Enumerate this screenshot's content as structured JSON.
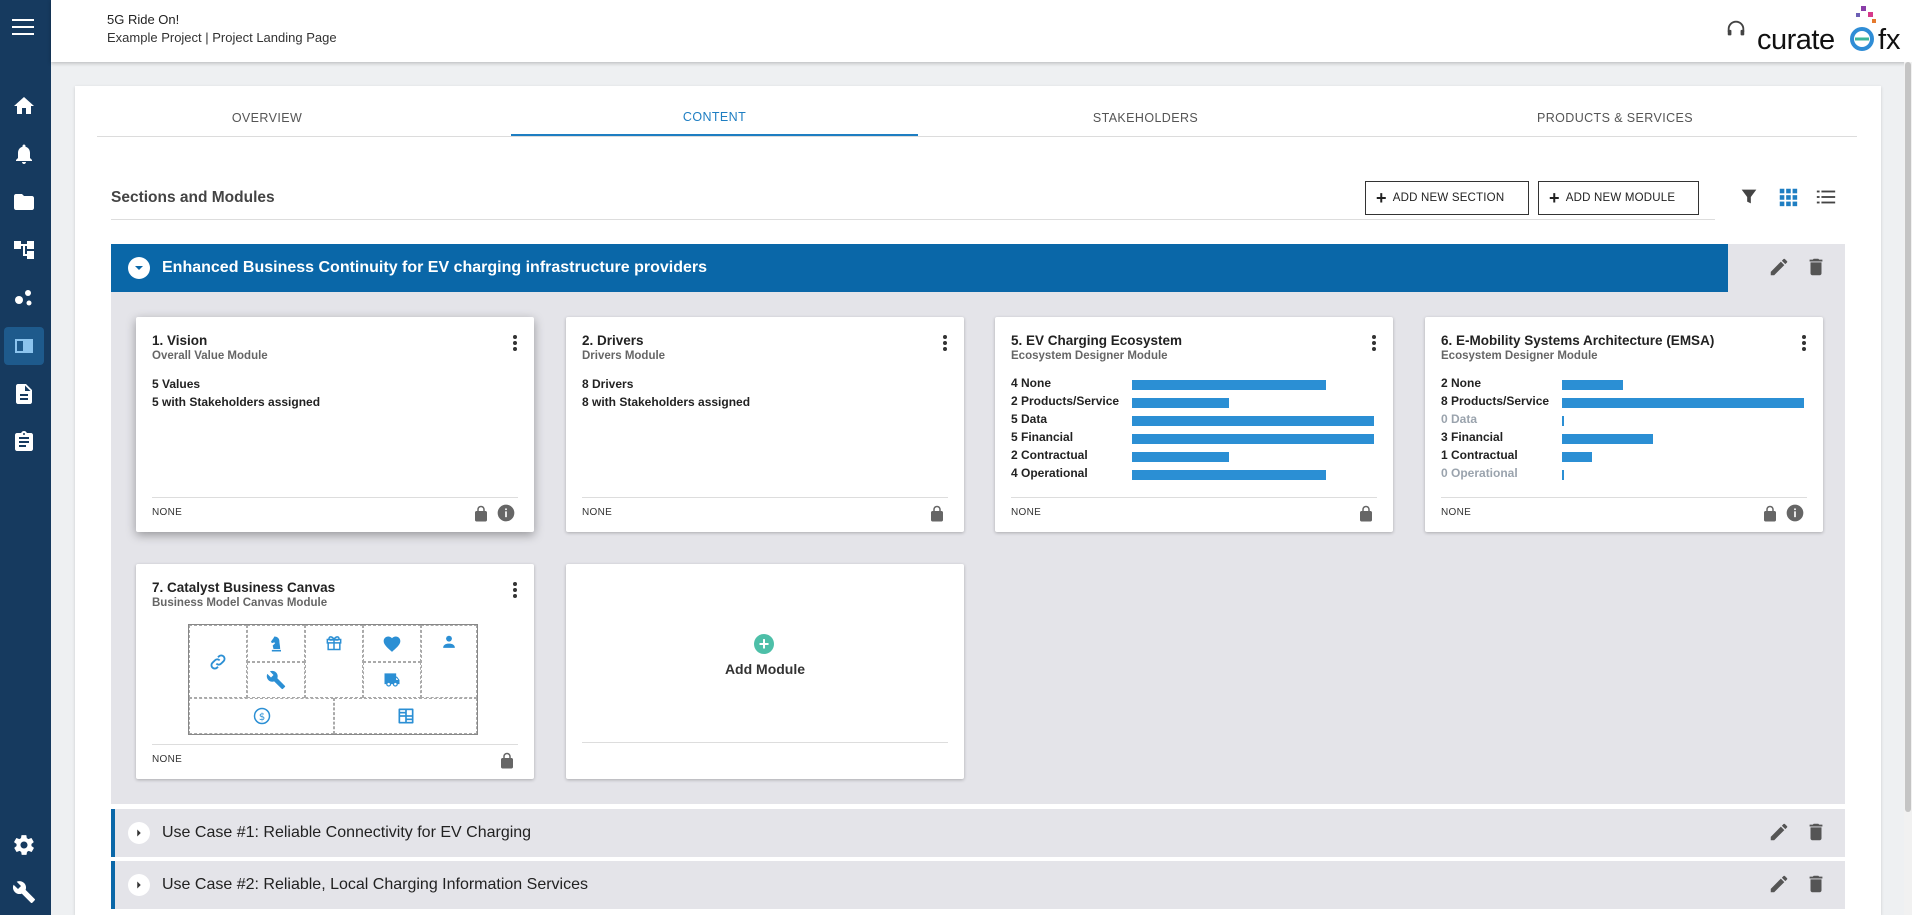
{
  "header": {
    "project_title": "5G Ride On!",
    "breadcrumb": "Example Project | Project Landing Page",
    "logo_word": "curate",
    "logo_suffix": "fx"
  },
  "nav": {
    "items": [
      "home-icon",
      "bell-icon",
      "folder-icon",
      "hierarchy-icon",
      "network-icon",
      "book-icon",
      "document-icon",
      "clipboard-icon"
    ],
    "bottom": [
      "gear-icon",
      "wrench-icon"
    ]
  },
  "tabs": [
    {
      "label": "OVERVIEW"
    },
    {
      "label": "CONTENT",
      "active": true
    },
    {
      "label": "STAKEHOLDERS"
    },
    {
      "label": "PRODUCTS & SERVICES"
    }
  ],
  "content": {
    "heading": "Sections and Modules",
    "add_section_label": "ADD NEW SECTION",
    "add_module_label": "ADD NEW MODULE"
  },
  "section": {
    "title": "Enhanced Business Continuity for EV charging infrastructure providers",
    "accent": "#0a67a8"
  },
  "cards": [
    {
      "title": "1. Vision",
      "subtitle": "Overall Value Module",
      "lines": [
        "5 Values",
        "5 with Stakeholders assigned"
      ],
      "footer": "NONE"
    },
    {
      "title": "2. Drivers",
      "subtitle": "Drivers Module",
      "lines": [
        "8 Drivers",
        "8 with Stakeholders assigned"
      ],
      "footer": "NONE"
    },
    {
      "title": "5. EV Charging Ecosystem",
      "subtitle": "Ecosystem Designer Module",
      "footer": "NONE",
      "bars": [
        {
          "label": "4 None",
          "value": 4
        },
        {
          "label": "2 Products/Service",
          "value": 2
        },
        {
          "label": "5 Data",
          "value": 5
        },
        {
          "label": "5 Financial",
          "value": 5
        },
        {
          "label": "2 Contractual",
          "value": 2
        },
        {
          "label": "4 Operational",
          "value": 4
        }
      ]
    },
    {
      "title": "6. E-Mobility Systems Architecture (EMSA)",
      "subtitle": "Ecosystem Designer Module",
      "footer": "NONE",
      "bars": [
        {
          "label": "2 None",
          "value": 2
        },
        {
          "label": "8 Products/Service",
          "value": 8
        },
        {
          "label": "0 Data",
          "value": 0
        },
        {
          "label": "3 Financial",
          "value": 3
        },
        {
          "label": "1 Contractual",
          "value": 1
        },
        {
          "label": "0 Operational",
          "value": 0
        }
      ]
    },
    {
      "title": "7. Catalyst Business Canvas",
      "subtitle": "Business Model Canvas Module",
      "footer": "NONE"
    }
  ],
  "add_module_label": "Add Module",
  "collapsed_sections": [
    {
      "title": "Use Case #1: Reliable Connectivity for EV Charging"
    },
    {
      "title": "Use Case #2: Reliable, Local Charging Information Services"
    }
  ],
  "colors": {
    "bar": "#2b8fd4",
    "rail": "#163a5f",
    "tab_active": "#1e7ec2"
  }
}
